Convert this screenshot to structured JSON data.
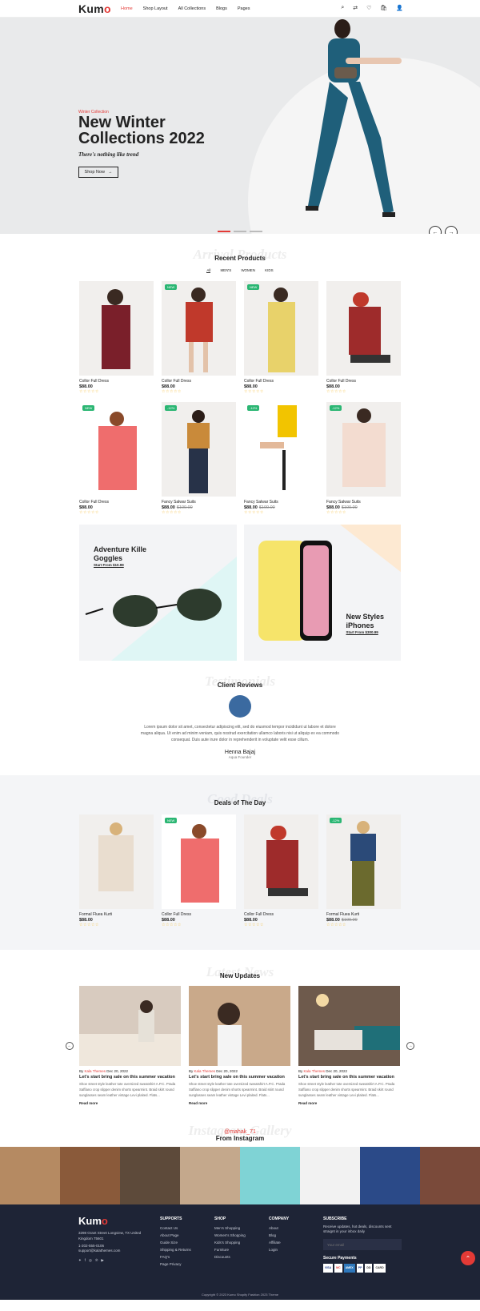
{
  "nav": {
    "logo_k": "Kum",
    "logo_o": "o",
    "items": [
      "Home",
      "Shop Layout",
      "All Collections",
      "Blogs",
      "Pages"
    ]
  },
  "hero": {
    "kicker": "Winter Collection",
    "title": "New Winter Collections 2022",
    "tagline": "There's nothing like trend",
    "button": "Shop Now",
    "arrow": "→",
    "prev": "←",
    "next": "→"
  },
  "arrival": {
    "ghost": "Arrival Products",
    "title": "Recent Products",
    "tabs": [
      "All",
      "MEN'S",
      "WOMEN",
      "KIDS"
    ]
  },
  "products": [
    {
      "name": "Collor Full Dress",
      "price": "$88.00",
      "old": "",
      "badge": "",
      "stars": "☆☆☆☆☆"
    },
    {
      "name": "Collor Full Dress",
      "price": "$88.00",
      "old": "",
      "badge": "NEW",
      "stars": "☆☆☆☆☆"
    },
    {
      "name": "Collor Full Dress",
      "price": "$88.00",
      "old": "",
      "badge": "NEW",
      "stars": "☆☆☆☆☆"
    },
    {
      "name": "Collor Full Dress",
      "price": "$88.00",
      "old": "",
      "badge": "",
      "stars": "☆☆☆☆☆"
    },
    {
      "name": "Collor Full Dress",
      "price": "$88.00",
      "old": "",
      "badge": "NEW",
      "stars": "☆☆☆☆☆"
    },
    {
      "name": "Fancy Salwar Suits",
      "price": "$88.00",
      "old": "$100.00",
      "badge": "-12%",
      "stars": "☆☆☆☆☆"
    },
    {
      "name": "Fancy Salwar Suits",
      "price": "$88.00",
      "old": "$100.00",
      "badge": "-12%",
      "stars": "☆☆☆☆☆"
    },
    {
      "name": "Fancy Salwar Suits",
      "price": "$88.00",
      "old": "$100.00",
      "badge": "-12%",
      "stars": "☆☆☆☆☆"
    }
  ],
  "promo": [
    {
      "title": "Adventure Kille Goggles",
      "sub": "Start From $10.99"
    },
    {
      "title": "New Styles iPhones",
      "sub": "Start From $300.99"
    }
  ],
  "testimonial": {
    "ghost": "Testimonials",
    "title": "Client Reviews",
    "text": "Lorem ipsum dolor sit amet, consectetur adipiscing elit, sed do eiusmod tempor incididunt ut labore et dolore magna aliqua. Ut enim ad minim veniam, quis nostrud exercitation ullamco laboris nisi ut aliquip ex ea commodo consequat. Duis aute irure dolor in reprehenderit in voluptate velit esse cillum.",
    "name": "Henna Bajaj",
    "role": "Aqua Founder"
  },
  "deals": {
    "ghost": "Good Deals",
    "title": "Deals of The Day",
    "items": [
      {
        "name": "Formal Fluea Kurti",
        "price": "$88.00",
        "old": "",
        "badge": "",
        "stars": "☆☆☆☆☆"
      },
      {
        "name": "Collor Full Dress",
        "price": "$88.00",
        "old": "",
        "badge": "NEW",
        "stars": "☆☆☆☆☆"
      },
      {
        "name": "Collor Full Dress",
        "price": "$88.00",
        "old": "",
        "badge": "",
        "stars": "☆☆☆☆☆"
      },
      {
        "name": "Formal Fluea Kurti",
        "price": "$88.00",
        "old": "$100.00",
        "badge": "-12%",
        "stars": "☆☆☆☆☆"
      }
    ]
  },
  "news": {
    "ghost": "Latest News",
    "title": "New Updates",
    "posts": [
      {
        "by": "By",
        "author": "Kala Themes",
        "date": "Dec 20, 2022",
        "title": "Let's start bring sale on this summer vacation",
        "text": "Shoe street style leather tote oversized sweatshirt A.P.C. Prada Saffiano crop slipper denim shorts spearmint. Braid skirt round sunglasses seam leather vintage Levi plaited. Flats...",
        "more": "Read more"
      },
      {
        "by": "By",
        "author": "Kala Themes",
        "date": "Dec 20, 2022",
        "title": "Let's start bring sale on this summer vacation",
        "text": "Shoe street style leather tote oversized sweatshirt A.P.C. Prada Saffiano crop slipper denim shorts spearmint. Braid skirt round sunglasses seam leather vintage Levi plaited. Flats...",
        "more": "Read more"
      },
      {
        "by": "By",
        "author": "Kala Themes",
        "date": "Dec 20, 2022",
        "title": "Let's start bring sale on this summer vacation",
        "text": "Shoe street style leather tote oversized sweatshirt A.P.C. Prada Saffiano crop slipper denim shorts spearmint. Braid skirt round sunglasses seam leather vintage Levi plaited. Flats...",
        "more": "Read more"
      }
    ]
  },
  "instagram": {
    "ghost": "Instagram Gallery",
    "handle": "@mahak_71",
    "title": "From Instagram"
  },
  "footer": {
    "logo_k": "Kum",
    "logo_o": "o",
    "address": "3298 Grant Street Longview, TX United Kingdom 75601",
    "phone": "1-202-555-0106",
    "email": "support@kalathemes.com",
    "supports": {
      "title": "SUPPORTS",
      "items": [
        "Contact Us",
        "About Page",
        "Guide Size",
        "Shipping & Returns",
        "FAQ's",
        "Page Privacy"
      ]
    },
    "shop": {
      "title": "SHOP",
      "items": [
        "Men's Shopping",
        "Women's Shopping",
        "Kids's Shopping",
        "Furniture",
        "Discounts"
      ]
    },
    "company": {
      "title": "COMPANY",
      "items": [
        "About",
        "Blog",
        "Affiliate",
        "Login"
      ]
    },
    "subscribe": {
      "title": "SUBSCRIBE",
      "text": "Receive updates, hot deals, discounts sent straignt in your inbox daily",
      "placeholder": "Your email",
      "secure": "Secure Payments",
      "cards": [
        "VISA",
        "MC",
        "AMEX",
        "PP",
        "DD",
        "CARD"
      ]
    },
    "copyright": "Copyright © 2023 Kumo Shopify Fashion 2023 Theme"
  },
  "colors": {
    "accent": "#e43a36",
    "footer": "#1e2436",
    "badge": "#2bb673"
  }
}
